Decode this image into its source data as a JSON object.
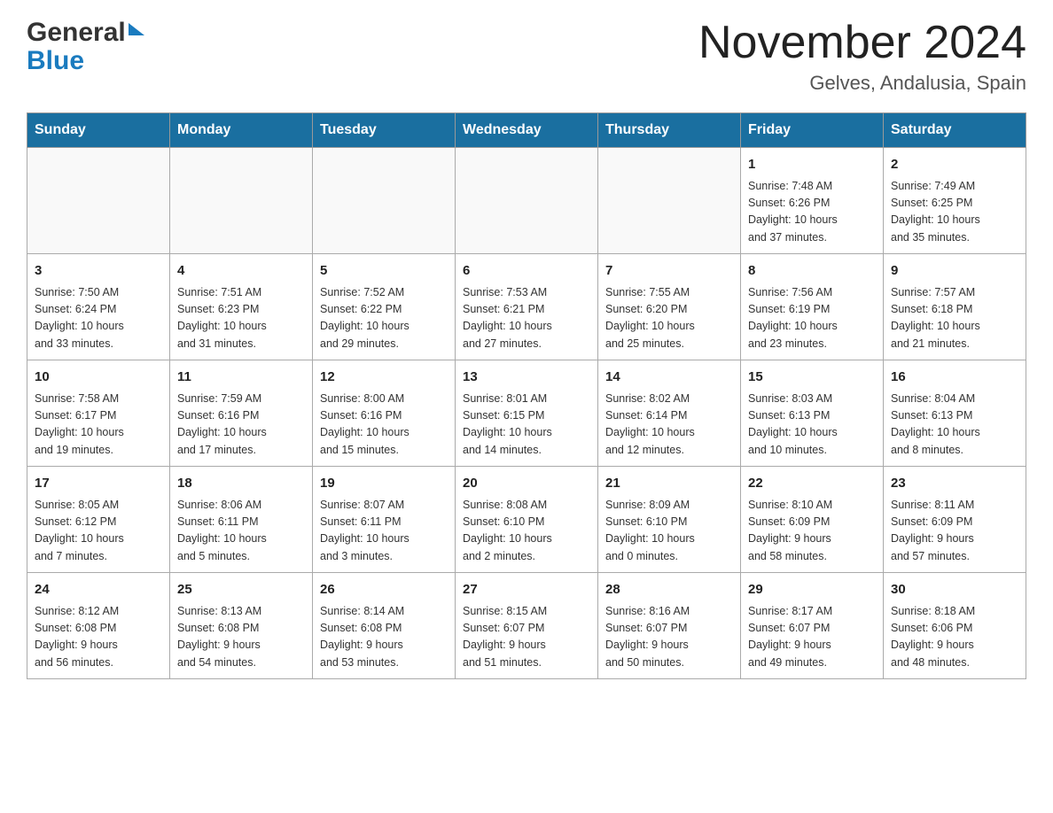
{
  "header": {
    "month_title": "November 2024",
    "location": "Gelves, Andalusia, Spain",
    "logo_general": "General",
    "logo_blue": "Blue"
  },
  "calendar": {
    "days_of_week": [
      "Sunday",
      "Monday",
      "Tuesday",
      "Wednesday",
      "Thursday",
      "Friday",
      "Saturday"
    ],
    "weeks": [
      [
        {
          "day": "",
          "info": ""
        },
        {
          "day": "",
          "info": ""
        },
        {
          "day": "",
          "info": ""
        },
        {
          "day": "",
          "info": ""
        },
        {
          "day": "",
          "info": ""
        },
        {
          "day": "1",
          "info": "Sunrise: 7:48 AM\nSunset: 6:26 PM\nDaylight: 10 hours\nand 37 minutes."
        },
        {
          "day": "2",
          "info": "Sunrise: 7:49 AM\nSunset: 6:25 PM\nDaylight: 10 hours\nand 35 minutes."
        }
      ],
      [
        {
          "day": "3",
          "info": "Sunrise: 7:50 AM\nSunset: 6:24 PM\nDaylight: 10 hours\nand 33 minutes."
        },
        {
          "day": "4",
          "info": "Sunrise: 7:51 AM\nSunset: 6:23 PM\nDaylight: 10 hours\nand 31 minutes."
        },
        {
          "day": "5",
          "info": "Sunrise: 7:52 AM\nSunset: 6:22 PM\nDaylight: 10 hours\nand 29 minutes."
        },
        {
          "day": "6",
          "info": "Sunrise: 7:53 AM\nSunset: 6:21 PM\nDaylight: 10 hours\nand 27 minutes."
        },
        {
          "day": "7",
          "info": "Sunrise: 7:55 AM\nSunset: 6:20 PM\nDaylight: 10 hours\nand 25 minutes."
        },
        {
          "day": "8",
          "info": "Sunrise: 7:56 AM\nSunset: 6:19 PM\nDaylight: 10 hours\nand 23 minutes."
        },
        {
          "day": "9",
          "info": "Sunrise: 7:57 AM\nSunset: 6:18 PM\nDaylight: 10 hours\nand 21 minutes."
        }
      ],
      [
        {
          "day": "10",
          "info": "Sunrise: 7:58 AM\nSunset: 6:17 PM\nDaylight: 10 hours\nand 19 minutes."
        },
        {
          "day": "11",
          "info": "Sunrise: 7:59 AM\nSunset: 6:16 PM\nDaylight: 10 hours\nand 17 minutes."
        },
        {
          "day": "12",
          "info": "Sunrise: 8:00 AM\nSunset: 6:16 PM\nDaylight: 10 hours\nand 15 minutes."
        },
        {
          "day": "13",
          "info": "Sunrise: 8:01 AM\nSunset: 6:15 PM\nDaylight: 10 hours\nand 14 minutes."
        },
        {
          "day": "14",
          "info": "Sunrise: 8:02 AM\nSunset: 6:14 PM\nDaylight: 10 hours\nand 12 minutes."
        },
        {
          "day": "15",
          "info": "Sunrise: 8:03 AM\nSunset: 6:13 PM\nDaylight: 10 hours\nand 10 minutes."
        },
        {
          "day": "16",
          "info": "Sunrise: 8:04 AM\nSunset: 6:13 PM\nDaylight: 10 hours\nand 8 minutes."
        }
      ],
      [
        {
          "day": "17",
          "info": "Sunrise: 8:05 AM\nSunset: 6:12 PM\nDaylight: 10 hours\nand 7 minutes."
        },
        {
          "day": "18",
          "info": "Sunrise: 8:06 AM\nSunset: 6:11 PM\nDaylight: 10 hours\nand 5 minutes."
        },
        {
          "day": "19",
          "info": "Sunrise: 8:07 AM\nSunset: 6:11 PM\nDaylight: 10 hours\nand 3 minutes."
        },
        {
          "day": "20",
          "info": "Sunrise: 8:08 AM\nSunset: 6:10 PM\nDaylight: 10 hours\nand 2 minutes."
        },
        {
          "day": "21",
          "info": "Sunrise: 8:09 AM\nSunset: 6:10 PM\nDaylight: 10 hours\nand 0 minutes."
        },
        {
          "day": "22",
          "info": "Sunrise: 8:10 AM\nSunset: 6:09 PM\nDaylight: 9 hours\nand 58 minutes."
        },
        {
          "day": "23",
          "info": "Sunrise: 8:11 AM\nSunset: 6:09 PM\nDaylight: 9 hours\nand 57 minutes."
        }
      ],
      [
        {
          "day": "24",
          "info": "Sunrise: 8:12 AM\nSunset: 6:08 PM\nDaylight: 9 hours\nand 56 minutes."
        },
        {
          "day": "25",
          "info": "Sunrise: 8:13 AM\nSunset: 6:08 PM\nDaylight: 9 hours\nand 54 minutes."
        },
        {
          "day": "26",
          "info": "Sunrise: 8:14 AM\nSunset: 6:08 PM\nDaylight: 9 hours\nand 53 minutes."
        },
        {
          "day": "27",
          "info": "Sunrise: 8:15 AM\nSunset: 6:07 PM\nDaylight: 9 hours\nand 51 minutes."
        },
        {
          "day": "28",
          "info": "Sunrise: 8:16 AM\nSunset: 6:07 PM\nDaylight: 9 hours\nand 50 minutes."
        },
        {
          "day": "29",
          "info": "Sunrise: 8:17 AM\nSunset: 6:07 PM\nDaylight: 9 hours\nand 49 minutes."
        },
        {
          "day": "30",
          "info": "Sunrise: 8:18 AM\nSunset: 6:06 PM\nDaylight: 9 hours\nand 48 minutes."
        }
      ]
    ]
  }
}
